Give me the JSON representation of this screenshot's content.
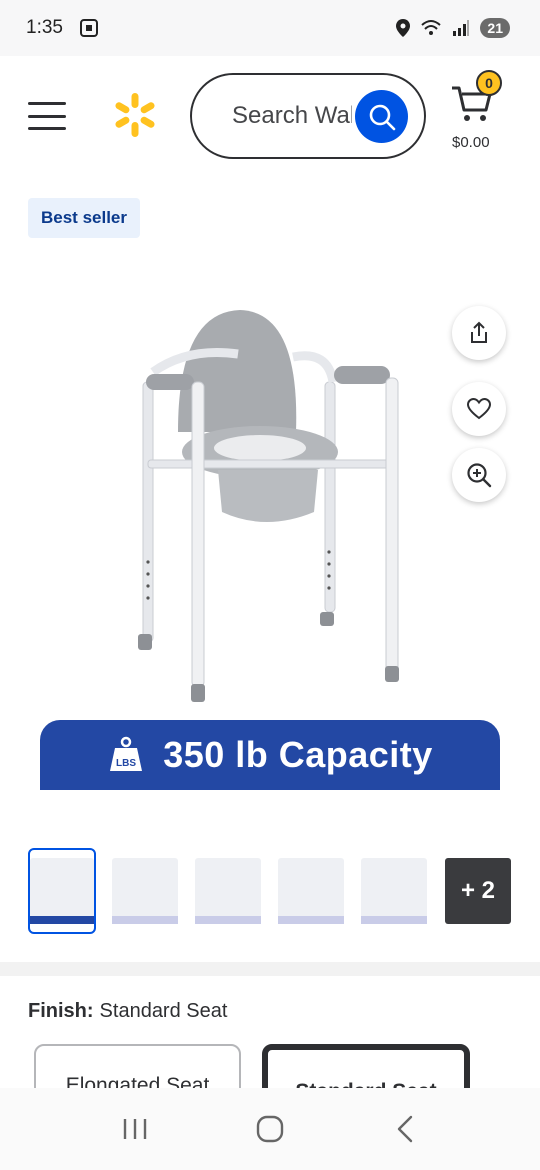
{
  "status_bar": {
    "time": "1:35",
    "battery": "21"
  },
  "header": {
    "search": {
      "placeholder": "Search Walmart",
      "visible_text": "Search Wal"
    },
    "cart": {
      "count": "0",
      "total": "$0.00"
    }
  },
  "product": {
    "badge": "Best seller",
    "banner": {
      "weight_icon_text": "LBS",
      "text": "350 lb Capacity"
    },
    "thumbnails": {
      "count_visible": 6,
      "more_label": "+ 2"
    },
    "finish": {
      "label": "Finish:",
      "value": "Standard Seat"
    },
    "options": [
      {
        "label": "Elongated Seat",
        "selected": false
      },
      {
        "label": "Standard Seat",
        "selected": true
      }
    ]
  },
  "colors": {
    "walmart_blue": "#0053e2",
    "spark_yellow": "#ffc220",
    "banner_blue": "#2348a4"
  },
  "icons": [
    "menu-icon",
    "walmart-spark-icon",
    "search-icon",
    "cart-icon",
    "share-icon",
    "heart-icon",
    "zoom-in-icon",
    "recents-icon",
    "home-icon",
    "back-icon"
  ]
}
